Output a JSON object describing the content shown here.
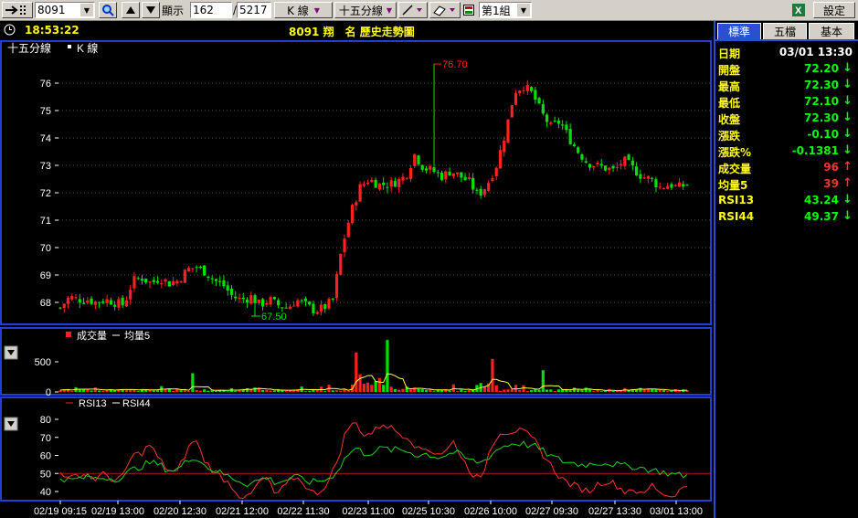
{
  "toolbar": {
    "symbol": "8091",
    "display_label": "顯示",
    "count": "162",
    "total": "5217",
    "kline_label": "K 線",
    "period_label": "十五分線",
    "group_label": "第1組",
    "settings_label": "設定"
  },
  "status": {
    "time": "18:53:22",
    "title": "8091 翔　名 歷史走勢圖"
  },
  "price_legend": {
    "period": "十五分線",
    "series": "K 線"
  },
  "volume_legend": {
    "s1": "成交量",
    "s2": "均量5"
  },
  "rsi_legend": {
    "s1": "RSI13",
    "s2": "RSI44"
  },
  "colors": {
    "up": "#ff2020",
    "down": "#00e000",
    "border": "#1f3fd8",
    "axis_text": "#ffffff",
    "vol_avg": "#ffff40",
    "rsi13": "#ff3030",
    "rsi44": "#20d020",
    "grid": "#555555"
  },
  "panel": {
    "tabs": [
      "標準",
      "五檔",
      "基本"
    ],
    "rows": [
      {
        "label": "日期",
        "value": "03/01 13:30",
        "dir": "",
        "color": "#ffffff"
      },
      {
        "label": "開盤",
        "value": "72.20",
        "dir": "down",
        "color": "#00ff00"
      },
      {
        "label": "最高",
        "value": "72.30",
        "dir": "down",
        "color": "#00ff00"
      },
      {
        "label": "最低",
        "value": "72.10",
        "dir": "down",
        "color": "#00ff00"
      },
      {
        "label": "收盤",
        "value": "72.30",
        "dir": "down",
        "color": "#00ff00"
      },
      {
        "label": "漲跌",
        "value": "-0.10",
        "dir": "down",
        "color": "#00ff00"
      },
      {
        "label": "漲跌%",
        "value": "-0.1381",
        "dir": "down",
        "color": "#00ff00"
      },
      {
        "label": "成交量",
        "value": "96",
        "dir": "up",
        "color": "#ff3030"
      },
      {
        "label": "均量5",
        "value": "39",
        "dir": "up",
        "color": "#ff3030"
      },
      {
        "label": "RSI13",
        "value": "43.24",
        "dir": "down",
        "color": "#00ff00"
      },
      {
        "label": "RSI44",
        "value": "49.37",
        "dir": "down",
        "color": "#00ff00"
      }
    ]
  },
  "chart_data": [
    {
      "type": "candlestick",
      "title": "8091 翔　名 歷史走勢圖",
      "ylim": [
        67.3,
        76.8
      ],
      "yticks": [
        68,
        69,
        70,
        71,
        72,
        73,
        74,
        75,
        76
      ],
      "annotations": [
        {
          "label": "76.70",
          "value": 76.7
        },
        {
          "label": "67.50",
          "value": 67.5
        }
      ],
      "close_path": [
        67.8,
        68.2,
        68.1,
        68.1,
        68.0,
        68.1,
        68.0,
        67.9,
        68.8,
        68.9,
        68.7,
        68.9,
        68.7,
        68.8,
        69.2,
        69.3,
        69.1,
        68.8,
        68.6,
        68.2,
        68.1,
        68.2,
        67.9,
        68.1,
        67.9,
        67.8,
        68.1,
        67.9,
        67.7,
        67.8,
        68.1,
        70.0,
        71.3,
        72.2,
        72.5,
        72.3,
        72.3,
        72.4,
        72.6,
        73.4,
        72.9,
        72.8,
        72.6,
        72.8,
        72.6,
        72.4,
        71.9,
        72.3,
        73.0,
        74.2,
        75.7,
        75.9,
        75.6,
        74.9,
        74.4,
        74.6,
        74.0,
        73.5,
        73.1,
        73.0,
        72.9,
        72.8,
        73.2,
        72.9,
        72.6,
        72.5,
        72.2,
        72.3,
        72.2,
        72.3
      ],
      "n_candles": 162
    },
    {
      "type": "bar",
      "series": [
        {
          "name": "成交量"
        },
        {
          "name": "均量5"
        }
      ],
      "yticks": [
        0,
        500
      ],
      "ylim": [
        0,
        800
      ],
      "peaks": [
        {
          "at": 0.21,
          "value": 310
        },
        {
          "at": 0.47,
          "value": 480
        },
        {
          "at": 0.52,
          "value": 800
        },
        {
          "at": 0.69,
          "value": 410
        },
        {
          "at": 0.77,
          "value": 360
        }
      ]
    },
    {
      "type": "line",
      "series": [
        {
          "name": "RSI13"
        },
        {
          "name": "RSI44"
        }
      ],
      "yticks": [
        40,
        50,
        60,
        70,
        80
      ],
      "ylim": [
        33,
        86
      ],
      "rsi13": [
        52,
        46,
        50,
        49,
        47,
        50,
        46,
        48,
        60,
        61,
        66,
        58,
        52,
        50,
        61,
        70,
        58,
        52,
        48,
        44,
        38,
        36,
        44,
        48,
        38,
        42,
        48,
        46,
        39,
        40,
        46,
        58,
        75,
        78,
        71,
        73,
        78,
        75,
        72,
        70,
        63,
        64,
        61,
        62,
        68,
        57,
        50,
        46,
        64,
        73,
        73,
        74,
        72,
        68,
        60,
        53,
        47,
        44,
        42,
        40,
        44,
        46,
        44,
        40,
        42,
        37,
        44,
        40,
        37,
        40,
        43
      ],
      "rsi44": [
        48,
        46,
        47,
        48,
        47,
        48,
        47,
        48,
        52,
        54,
        56,
        55,
        52,
        52,
        56,
        60,
        55,
        52,
        50,
        48,
        46,
        44,
        46,
        48,
        45,
        46,
        48,
        47,
        45,
        46,
        47,
        52,
        60,
        64,
        61,
        62,
        64,
        63,
        63,
        62,
        60,
        61,
        59,
        60,
        62,
        59,
        57,
        56,
        60,
        64,
        66,
        67,
        66,
        65,
        62,
        59,
        57,
        56,
        55,
        55,
        56,
        56,
        55,
        54,
        54,
        53,
        52,
        51,
        50,
        49,
        49
      ],
      "hline": 50
    }
  ],
  "xaxis": {
    "labels": [
      "02/19 09:15",
      "02/19 13:00",
      "02/20 12:30",
      "02/21 12:00",
      "02/22 11:30",
      "02/23 11:00",
      "02/25 10:30",
      "02/26 10:00",
      "02/27 09:30",
      "02/27 13:30",
      "03/01 13:00"
    ]
  }
}
